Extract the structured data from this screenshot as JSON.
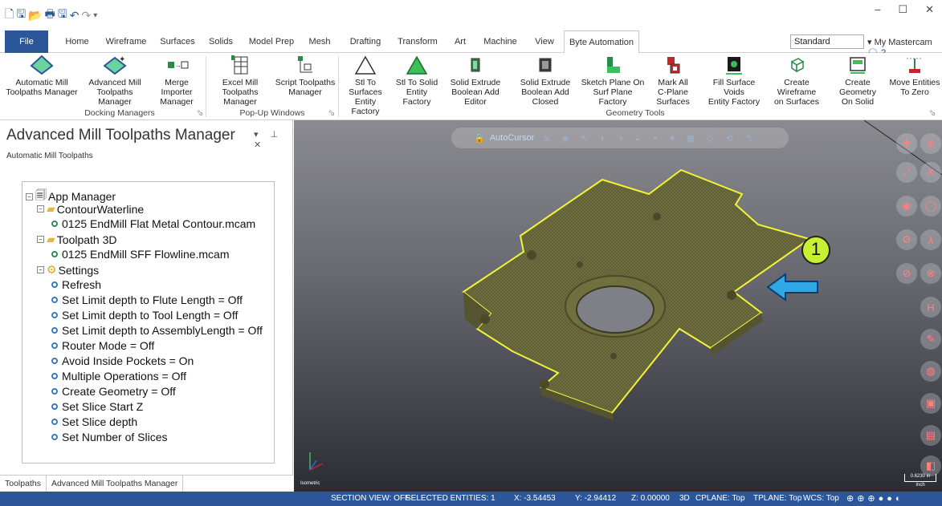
{
  "window": {
    "minimize": "–",
    "maximize": "☐",
    "close": "✕"
  },
  "tabs": [
    {
      "label": "File"
    },
    {
      "label": "Home"
    },
    {
      "label": "Wireframe"
    },
    {
      "label": "Surfaces"
    },
    {
      "label": "Solids"
    },
    {
      "label": "Model Prep"
    },
    {
      "label": "Mesh"
    },
    {
      "label": "Drafting"
    },
    {
      "label": "Transform"
    },
    {
      "label": "Art"
    },
    {
      "label": "Machine"
    },
    {
      "label": "View"
    },
    {
      "label": "Byte Automation"
    }
  ],
  "standard_select": "Standard",
  "my_mastercam": "My Mastercam",
  "ribbon": {
    "buttons": [
      {
        "l1": "Automatic Mill",
        "l2": "Toolpaths Manager"
      },
      {
        "l1": "Advanced Mill",
        "l2": "Toolpaths Manager"
      },
      {
        "l1": "Merge Importer",
        "l2": "Manager"
      },
      {
        "l1": "Excel Mill",
        "l2": "Toolpaths Manager"
      },
      {
        "l1": "Script Toolpaths",
        "l2": "Manager"
      },
      {
        "l1": "Stl To Surfaces",
        "l2": "Entity Factory"
      },
      {
        "l1": "Stl To Solid",
        "l2": "Entity Factory"
      },
      {
        "l1": "Solid Extrude",
        "l2": "Boolean Add Editor"
      },
      {
        "l1": "Solid Extrude",
        "l2": "Boolean Add Closed"
      },
      {
        "l1": "Sketch Plane On",
        "l2": "Surf Plane Factory"
      },
      {
        "l1": "Mark All",
        "l2": "C-Plane Surfaces"
      },
      {
        "l1": "Fill Surface Voids",
        "l2": "Entity Factory"
      },
      {
        "l1": "Create Wireframe",
        "l2": "on Surfaces"
      },
      {
        "l1": "Create Geometry",
        "l2": "On Solid"
      },
      {
        "l1": "Move Entities",
        "l2": "To Zero"
      }
    ],
    "groups": {
      "docking": "Docking Managers",
      "popup": "Pop-Up Windows",
      "geometry": "Geometry Tools"
    }
  },
  "panel": {
    "title": "Advanced Mill Toolpaths Manager",
    "controls": "▾ ⊥ ✕",
    "subtitle": "Automatic Mill Toolpaths",
    "tree": [
      "App Manager",
      "ContourWaterline",
      "0125 EndMill Flat Metal Contour.mcam",
      "Toolpath 3D",
      "0125 EndMill SFF Flowline.mcam",
      "Settings",
      "Refresh",
      "Set Limit depth to Flute Length = Off",
      "Set Limit depth to Tool Length = Off",
      "Set Limit depth to AssemblyLength = Off",
      "Router Mode = Off",
      "Avoid Inside Pockets = On",
      "Multiple Operations = Off",
      "Create Geometry = Off",
      "Set Slice Start Z",
      "Set Slice depth",
      "Set Number of Slices"
    ],
    "tabs": [
      "Toolpaths",
      "Advanced Mill Toolpaths Manager"
    ]
  },
  "viewport": {
    "autocursor": "AutoCursor",
    "callout": "1",
    "view_label": "Isometric",
    "scale_value": "0.6230 in",
    "scale_unit": "Inch"
  },
  "status": {
    "section": "SECTION VIEW: OFF",
    "selected": "SELECTED ENTITIES: 1",
    "x": "X:  -3.54453",
    "y": "Y:  -2.94412",
    "z": "Z: 0.00000",
    "mode": "3D",
    "cplane": "CPLANE: Top",
    "tplane": "TPLANE: Top",
    "wcs": "WCS: Top"
  },
  "colors": {
    "accent": "#2b579a",
    "part": "#6b6b3e",
    "highlight": "#f2f23a",
    "arrow": "#2fa8e6",
    "callout": "#c8f032"
  }
}
